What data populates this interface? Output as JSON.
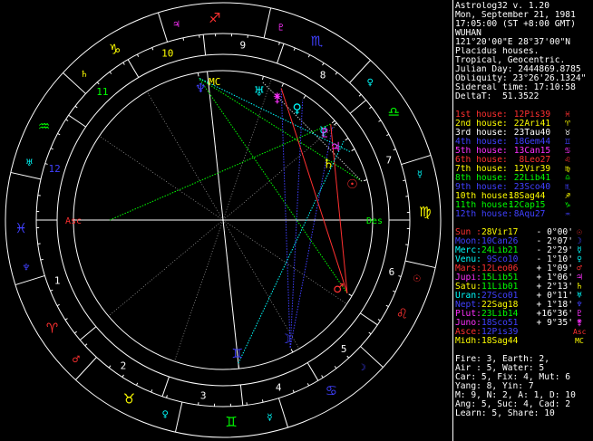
{
  "header": {
    "lines": [
      "Astrolog32 v. 1.20",
      "Mon, September 21, 1981",
      "17:05:00 (ST +8:00 GMT)",
      "WUHAN",
      "121°20'00\"E 28°37'00\"N",
      "Placidus houses.",
      "Tropical, Geocentric.",
      "Julian Day: 2444869.8785",
      "Obliquity: 23°26'26.1324\"",
      "Sidereal time: 17:10:58",
      "DeltaT:  51.3522"
    ]
  },
  "houses": [
    {
      "label": "1st house:",
      "value": " 12Pis39",
      "glyph": "♓",
      "color": "#ff3030"
    },
    {
      "label": "2nd house:",
      "value": " 22Ari41",
      "glyph": "♈",
      "color": "#ffff00"
    },
    {
      "label": "3rd house:",
      "value": " 23Tau40",
      "glyph": "♉",
      "color": "#ffffff"
    },
    {
      "label": "4th house:",
      "value": " 18Gem44",
      "glyph": "♊",
      "color": "#4040ff"
    },
    {
      "label": "5th house:",
      "value": " 13Can15",
      "glyph": "♋",
      "color": "#ff30ff"
    },
    {
      "label": "6th house:",
      "value": "  8Leo27",
      "glyph": "♌",
      "color": "#ff3030"
    },
    {
      "label": "7th house:",
      "value": " 12Vir39",
      "glyph": "♍",
      "color": "#ffff00"
    },
    {
      "label": "8th house:",
      "value": " 22Lib41",
      "glyph": "♎",
      "color": "#00ff00"
    },
    {
      "label": "9th house:",
      "value": " 23Sco40",
      "glyph": "♏",
      "color": "#4040ff"
    },
    {
      "label": "10th house:",
      "value": "18Sag44",
      "glyph": "♐",
      "color": "#ffff00"
    },
    {
      "label": "11th house:",
      "value": "12Cap15",
      "glyph": "♑",
      "color": "#00ff00"
    },
    {
      "label": "12th house:",
      "value": " 8Aqu27",
      "glyph": "♒",
      "color": "#4040ff"
    }
  ],
  "planets": [
    {
      "label": "Sun :",
      "pos": "28Vir17",
      "lat": " - 0°00'",
      "glyph": "☉",
      "color": "#ff3030",
      "poscolor": "#ffff00"
    },
    {
      "label": "Moon:",
      "pos": "10Can26",
      "lat": " - 2°07'",
      "glyph": "☽",
      "color": "#4040ff",
      "poscolor": "#4040ff"
    },
    {
      "label": "Merc:",
      "pos": "24Lib21",
      "lat": " - 2°29'",
      "glyph": "☿",
      "color": "#00ffff",
      "poscolor": "#00ff00"
    },
    {
      "label": "Venu:",
      "pos": " 9Sco10",
      "lat": " - 1°10'",
      "glyph": "♀",
      "color": "#00ffff",
      "poscolor": "#4040ff"
    },
    {
      "label": "Mars:",
      "pos": "12Leo06",
      "lat": " + 1°09'",
      "glyph": "♂",
      "color": "#ff3030",
      "poscolor": "#ff3030"
    },
    {
      "label": "Jupi:",
      "pos": "15Lib51",
      "lat": " + 1°06'",
      "glyph": "♃",
      "color": "#ff30ff",
      "poscolor": "#00ff00"
    },
    {
      "label": "Satu:",
      "pos": "11Lib01",
      "lat": " + 2°13'",
      "glyph": "♄",
      "color": "#ffff00",
      "poscolor": "#00ff00"
    },
    {
      "label": "Uran:",
      "pos": "27Sco01",
      "lat": " + 0°11'",
      "glyph": "♅",
      "color": "#00ffff",
      "poscolor": "#4040ff"
    },
    {
      "label": "Nept:",
      "pos": "22Sag18",
      "lat": " + 1°18'",
      "glyph": "♆",
      "color": "#4040ff",
      "poscolor": "#ffff00"
    },
    {
      "label": "Plut:",
      "pos": "23Lib14",
      "lat": " +16°36'",
      "glyph": "♇",
      "color": "#ff30ff",
      "poscolor": "#00ff00"
    },
    {
      "label": "Juno:",
      "pos": "18Sco51",
      "lat": " + 9°35'",
      "glyph": "⚵",
      "color": "#ff30ff",
      "poscolor": "#4040ff"
    },
    {
      "label": "Asce:",
      "pos": "12Pis39",
      "lat": "",
      "glyph": "Asc",
      "color": "#ff3030",
      "poscolor": "#4040ff"
    },
    {
      "label": "Midh:",
      "pos": "18Sag44",
      "lat": "",
      "glyph": "MC",
      "color": "#ffff00",
      "poscolor": "#ffff00"
    }
  ],
  "summary": [
    "Fire: 3, Earth: 2,",
    "Air : 5, Water: 5",
    "Car: 5, Fix: 4, Mut: 6",
    "Yang: 8, Yin: 7",
    "M: 9, N: 2, A: 1, D: 10",
    "Ang: 5, Suc: 4, Cad: 2",
    "Learn: 5, Share: 10"
  ],
  "wheel": {
    "signs": [
      {
        "name": "aries-sign",
        "glyph": "♈",
        "color": "#ff3030"
      },
      {
        "name": "taurus-sign",
        "glyph": "♉",
        "color": "#ffff00"
      },
      {
        "name": "gemini-sign",
        "glyph": "♊",
        "color": "#00ff00"
      },
      {
        "name": "cancer-sign",
        "glyph": "♋",
        "color": "#4040ff"
      },
      {
        "name": "leo-sign",
        "glyph": "♌",
        "color": "#ff3030"
      },
      {
        "name": "virgo-sign",
        "glyph": "♍",
        "color": "#ffff00"
      },
      {
        "name": "libra-sign",
        "glyph": "♎",
        "color": "#00ff00"
      },
      {
        "name": "scorpio-sign",
        "glyph": "♏",
        "color": "#4040ff"
      },
      {
        "name": "sagittarius-sign",
        "glyph": "♐",
        "color": "#ff3030"
      },
      {
        "name": "capricorn-sign",
        "glyph": "♑",
        "color": "#ffff00"
      },
      {
        "name": "aquarius-sign",
        "glyph": "♒",
        "color": "#00ff00"
      },
      {
        "name": "pisces-sign",
        "glyph": "♓",
        "color": "#4040ff"
      }
    ],
    "rulers": [
      {
        "glyph": "♂",
        "color": "#ff3030"
      },
      {
        "glyph": "♀",
        "color": "#00ffff"
      },
      {
        "glyph": "☿",
        "color": "#00ffff"
      },
      {
        "glyph": "☽",
        "color": "#4040ff"
      },
      {
        "glyph": "☉",
        "color": "#ff3030"
      },
      {
        "glyph": "☿",
        "color": "#00ffff"
      },
      {
        "glyph": "♀",
        "color": "#00ffff"
      },
      {
        "glyph": "♇",
        "color": "#ff30ff"
      },
      {
        "glyph": "♃",
        "color": "#ff30ff"
      },
      {
        "glyph": "♄",
        "color": "#ffff00"
      },
      {
        "glyph": "♅",
        "color": "#00ffff"
      },
      {
        "glyph": "♆",
        "color": "#4040ff"
      }
    ],
    "house_numbers": [
      "1",
      "2",
      "3",
      "4",
      "5",
      "6",
      "7",
      "8",
      "9",
      "10",
      "11",
      "12"
    ],
    "asc_label": "Asc",
    "des_label": "Des",
    "mc_label": "MC",
    "planet_glyphs": [
      {
        "name": "sun-glyph",
        "glyph": "☉",
        "color": "#ff3030",
        "lon": 178.28
      },
      {
        "name": "moon-glyph",
        "glyph": "☽",
        "color": "#4040ff",
        "lon": 100.43
      },
      {
        "name": "mercury-glyph",
        "glyph": "☿",
        "color": "#00ffff",
        "lon": 204.35
      },
      {
        "name": "venus-glyph",
        "glyph": "♀",
        "color": "#00ffff",
        "lon": 219.17
      },
      {
        "name": "mars-glyph",
        "glyph": "♂",
        "color": "#ff3030",
        "lon": 132.1
      },
      {
        "name": "jupiter-glyph",
        "glyph": "♃",
        "color": "#ff30ff",
        "lon": 195.85
      },
      {
        "name": "saturn-glyph",
        "glyph": "♄",
        "color": "#ffff00",
        "lon": 191.02
      },
      {
        "name": "uranus-glyph",
        "glyph": "♅",
        "color": "#00ffff",
        "lon": 237.02
      },
      {
        "name": "neptune-glyph",
        "glyph": "♆",
        "color": "#4040ff",
        "lon": 262.3
      },
      {
        "name": "pluto-glyph",
        "glyph": "♇",
        "color": "#ff30ff",
        "lon": 203.23
      },
      {
        "name": "juno-glyph",
        "glyph": "⚵",
        "color": "#ff30ff",
        "lon": 228.85
      },
      {
        "name": "gemini-marker-glyph",
        "glyph": "♊",
        "color": "#4040ff",
        "lon": 78.73
      }
    ]
  }
}
